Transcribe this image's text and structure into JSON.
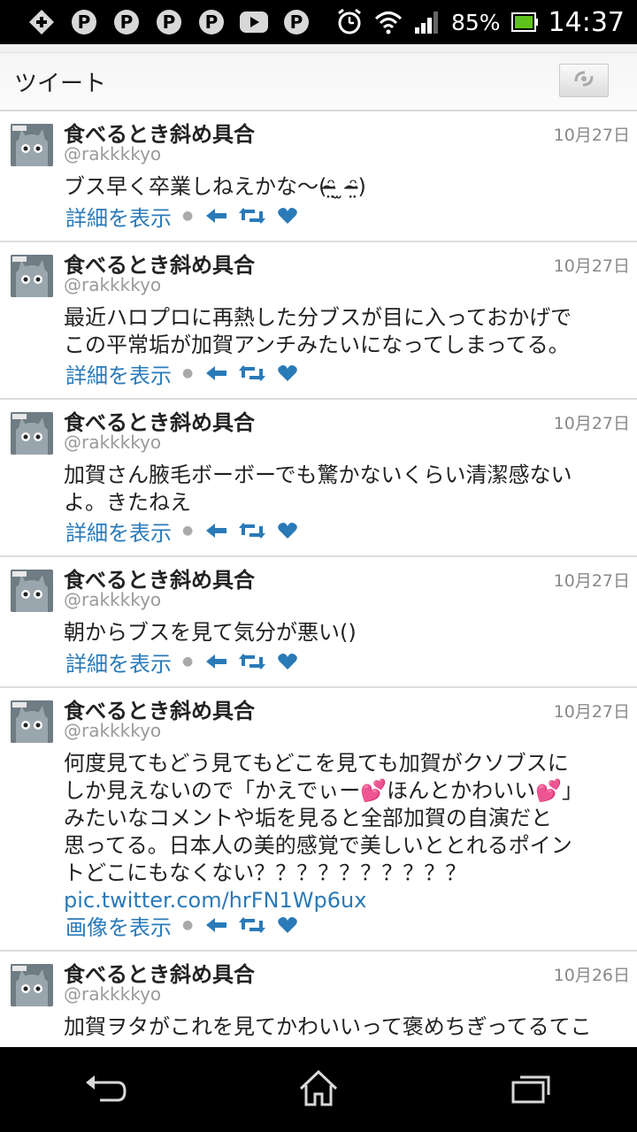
{
  "status_bar": {
    "left_icons": [
      "plus-icon",
      "pinterest-icon",
      "pinterest-icon",
      "pinterest-icon",
      "pinterest-icon",
      "youtube-icon",
      "pinterest-icon"
    ],
    "battery_percent": "85%",
    "time": "14:37"
  },
  "header": {
    "title": "ツイート"
  },
  "tweets": [
    {
      "name": "食べるとき斜め具合",
      "handle": "@rakkkkyo",
      "date": "10月27日",
      "text_lines": [
        "ブス早く卒業しねえかな〜(ᵔ̴̶̤ ̫ ᵔ̴̶̤)"
      ],
      "action_label": "詳細を表示"
    },
    {
      "name": "食べるとき斜め具合",
      "handle": "@rakkkkyo",
      "date": "10月27日",
      "text_lines": [
        "最近ハロプロに再熱した分ブスが目に入っておかげで",
        "この平常垢が加賀アンチみたいになってしまってる。"
      ],
      "action_label": "詳細を表示"
    },
    {
      "name": "食べるとき斜め具合",
      "handle": "@rakkkkyo",
      "date": "10月27日",
      "text_lines": [
        "加賀さん腋毛ボーボーでも驚かないくらい清潔感ない",
        "よ。きたねえ"
      ],
      "action_label": "詳細を表示"
    },
    {
      "name": "食べるとき斜め具合",
      "handle": "@rakkkkyo",
      "date": "10月27日",
      "text_lines": [
        "朝からブスを見て気分が悪い()"
      ],
      "action_label": "詳細を表示"
    },
    {
      "name": "食べるとき斜め具合",
      "handle": "@rakkkkyo",
      "date": "10月27日",
      "text_lines": [
        "何度見てもどう見てもどこを見ても加賀がクソブスに",
        "しか見えないので「かえでぃー💕ほんとかわいい💕」",
        "みたいなコメントや垢を見ると全部加賀の自演だと",
        "思ってる。日本人の美的感覚で美しいととれるポイン",
        "トどこにもなくない？？？？？？？？？？"
      ],
      "link": "pic.twitter.com/hrFN1Wp6ux",
      "action_label": "画像を表示"
    },
    {
      "name": "食べるとき斜め具合",
      "handle": "@rakkkkyo",
      "date": "10月26日",
      "text_lines": [
        "加賀ヲタがこれを見てかわいいって褒めちぎってるてこ"
      ],
      "action_label": ""
    }
  ],
  "colors": {
    "link": "#2a7ab8",
    "status_bar": "#000000",
    "battery_fill": "#5fc21b"
  }
}
